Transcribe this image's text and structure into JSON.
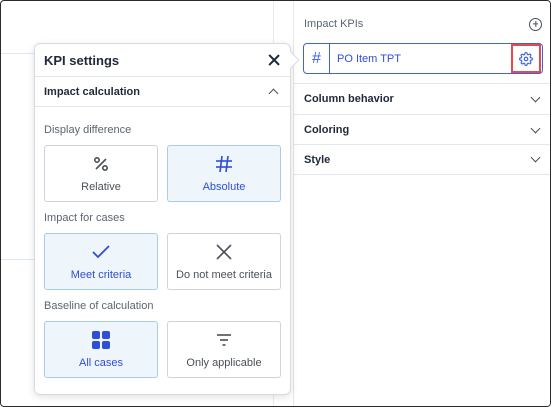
{
  "right_panel": {
    "title": "Impact KPIs",
    "kpi_field": {
      "hash": "#",
      "name": "PO Item TPT"
    },
    "sections": [
      {
        "label": "Column behavior"
      },
      {
        "label": "Coloring"
      },
      {
        "label": "Style"
      }
    ]
  },
  "popover": {
    "title": "KPI settings",
    "section_title": "Impact calculation",
    "groups": [
      {
        "label": "Display difference",
        "options": [
          {
            "label": "Relative",
            "icon": "percent-icon",
            "selected": false
          },
          {
            "label": "Absolute",
            "icon": "hash-icon",
            "selected": true
          }
        ]
      },
      {
        "label": "Impact for cases",
        "options": [
          {
            "label": "Meet criteria",
            "icon": "check-icon",
            "selected": true
          },
          {
            "label": "Do not meet criteria",
            "icon": "x-icon",
            "selected": false
          }
        ]
      },
      {
        "label": "Baseline of calculation",
        "options": [
          {
            "label": "All cases",
            "icon": "grid-icon",
            "selected": true
          },
          {
            "label": "Only applicable",
            "icon": "filter-icon",
            "selected": false
          }
        ]
      }
    ]
  },
  "colors": {
    "accent": "#2f4ed6",
    "selected_bg": "#eef6fc",
    "highlight_border": "#e5484d"
  }
}
